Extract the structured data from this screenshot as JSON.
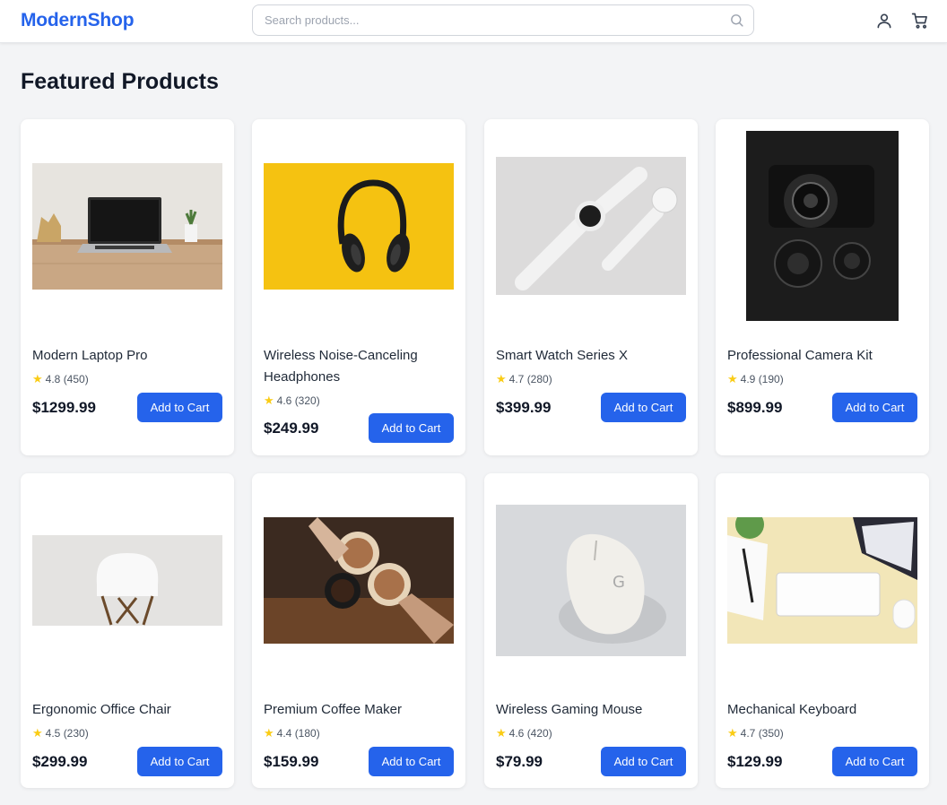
{
  "header": {
    "logo": "ModernShop",
    "search_placeholder": "Search products...",
    "icons": [
      "search-icon",
      "user-icon",
      "cart-icon"
    ]
  },
  "page_title": "Featured Products",
  "colors": {
    "accent": "#2563eb",
    "star": "#facc15",
    "background": "#f3f4f6"
  },
  "products": [
    {
      "name": "Modern Laptop Pro",
      "rating": "4.8",
      "reviews": "(450)",
      "price": "$1299.99",
      "button": "Add to Cart",
      "image": "laptop-on-desk-photo"
    },
    {
      "name": "Wireless Noise-Canceling Headphones",
      "rating": "4.6",
      "reviews": "(320)",
      "price": "$249.99",
      "button": "Add to Cart",
      "image": "headphones-on-yellow-photo"
    },
    {
      "name": "Smart Watch Series X",
      "rating": "4.7",
      "reviews": "(280)",
      "price": "$399.99",
      "button": "Add to Cart",
      "image": "white-smartwatch-photo"
    },
    {
      "name": "Professional Camera Kit",
      "rating": "4.9",
      "reviews": "(190)",
      "price": "$899.99",
      "button": "Add to Cart",
      "image": "camera-and-lenses-photo"
    },
    {
      "name": "Ergonomic Office Chair",
      "rating": "4.5",
      "reviews": "(230)",
      "price": "$299.99",
      "button": "Add to Cart",
      "image": "white-chair-photo"
    },
    {
      "name": "Premium Coffee Maker",
      "rating": "4.4",
      "reviews": "(180)",
      "price": "$159.99",
      "button": "Add to Cart",
      "image": "latte-cups-photo"
    },
    {
      "name": "Wireless Gaming Mouse",
      "rating": "4.6",
      "reviews": "(420)",
      "price": "$79.99",
      "button": "Add to Cart",
      "image": "white-gaming-mouse-photo"
    },
    {
      "name": "Mechanical Keyboard",
      "rating": "4.7",
      "reviews": "(350)",
      "price": "$129.99",
      "button": "Add to Cart",
      "image": "keyboard-on-desk-photo"
    }
  ]
}
